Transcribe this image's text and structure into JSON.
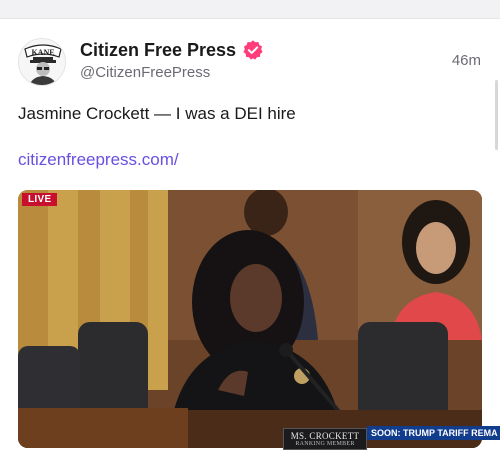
{
  "post": {
    "author_name": "Citizen Free Press",
    "author_handle": "@CitizenFreePress",
    "timestamp": "46m",
    "text": "Jasmine Crockett — I was a DEI hire",
    "link_text": "citizenfreepress.com/"
  },
  "avatar": {
    "logo_text": "KANE"
  },
  "media": {
    "live_badge": "LIVE",
    "nameplate_line1": "MS. CROCKETT",
    "nameplate_line2": "RANKING MEMBER",
    "ticker_text": "SOON: TRUMP TARIFF REMA"
  },
  "colors": {
    "link": "#6a4fe0",
    "verified": "#ff3d7a",
    "live": "#c8102e",
    "ticker": "#123c8c"
  },
  "icons": {
    "verified": "verified-badge-icon"
  }
}
